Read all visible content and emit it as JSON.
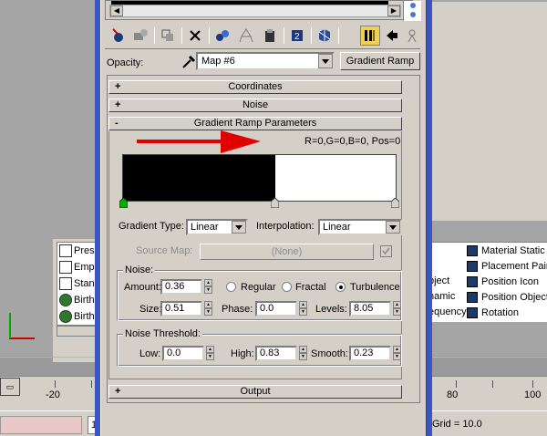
{
  "background": {
    "list_left": [
      "Prese",
      "Emp",
      "Stan",
      "Birth",
      "Birth"
    ],
    "list_right_left": [
      "bject",
      "namic",
      "equency"
    ],
    "list_right": [
      "Material Static",
      "Placement Paint",
      "Position Icon",
      "Position Object",
      "Rotation"
    ],
    "ruler_labels": [
      "-20",
      "80",
      "100"
    ],
    "status_field": "1",
    "grid_text": "Grid = 10.0"
  },
  "opacity": {
    "label": "Opacity:",
    "map_value": "Map #6",
    "type_button": "Gradient Ramp"
  },
  "rollouts": {
    "coordinates": {
      "sign": "+",
      "title": "Coordinates"
    },
    "noise": {
      "sign": "+",
      "title": "Noise"
    },
    "gradient": {
      "sign": "-",
      "title": "Gradient Ramp Parameters"
    },
    "output": {
      "sign": "+",
      "title": "Output"
    }
  },
  "gradient": {
    "readout": "R=0,G=0,B=0, Pos=0",
    "gradient_type_label": "Gradient Type:",
    "gradient_type_value": "Linear",
    "interpolation_label": "Interpolation:",
    "interpolation_value": "Linear",
    "source_map_label": "Source Map:",
    "source_map_value": "(None)"
  },
  "noise_group": {
    "title": "Noise:",
    "amount_label": "Amount:",
    "amount_value": "0.36",
    "regular_label": "Regular",
    "fractal_label": "Fractal",
    "turbulence_label": "Turbulence",
    "selected": "turbulence",
    "size_label": "Size:",
    "size_value": "0.51",
    "phase_label": "Phase:",
    "phase_value": "0.0",
    "levels_label": "Levels:",
    "levels_value": "8.05"
  },
  "noise_threshold": {
    "title": "Noise Threshold:",
    "low_label": "Low:",
    "low_value": "0.0",
    "high_label": "High:",
    "high_value": "0.83",
    "smooth_label": "Smooth:",
    "smooth_value": "0.23"
  },
  "toolbar": {
    "icons": [
      "get-material-icon",
      "put-to-scene-icon",
      "assign-to-selection-icon",
      "reset-map-icon",
      "make-unique-icon",
      "material-library-icon",
      "material-effects-icon",
      "show-map-icon",
      "show-end-result-icon",
      "go-to-parent-icon",
      "go-forward-icon",
      "select-by-material-icon"
    ]
  },
  "colors": {
    "panel": "#d4d0c8",
    "arrow": "#e00000",
    "flag_green": "#00b000",
    "title_blue": "#3b56c0"
  }
}
